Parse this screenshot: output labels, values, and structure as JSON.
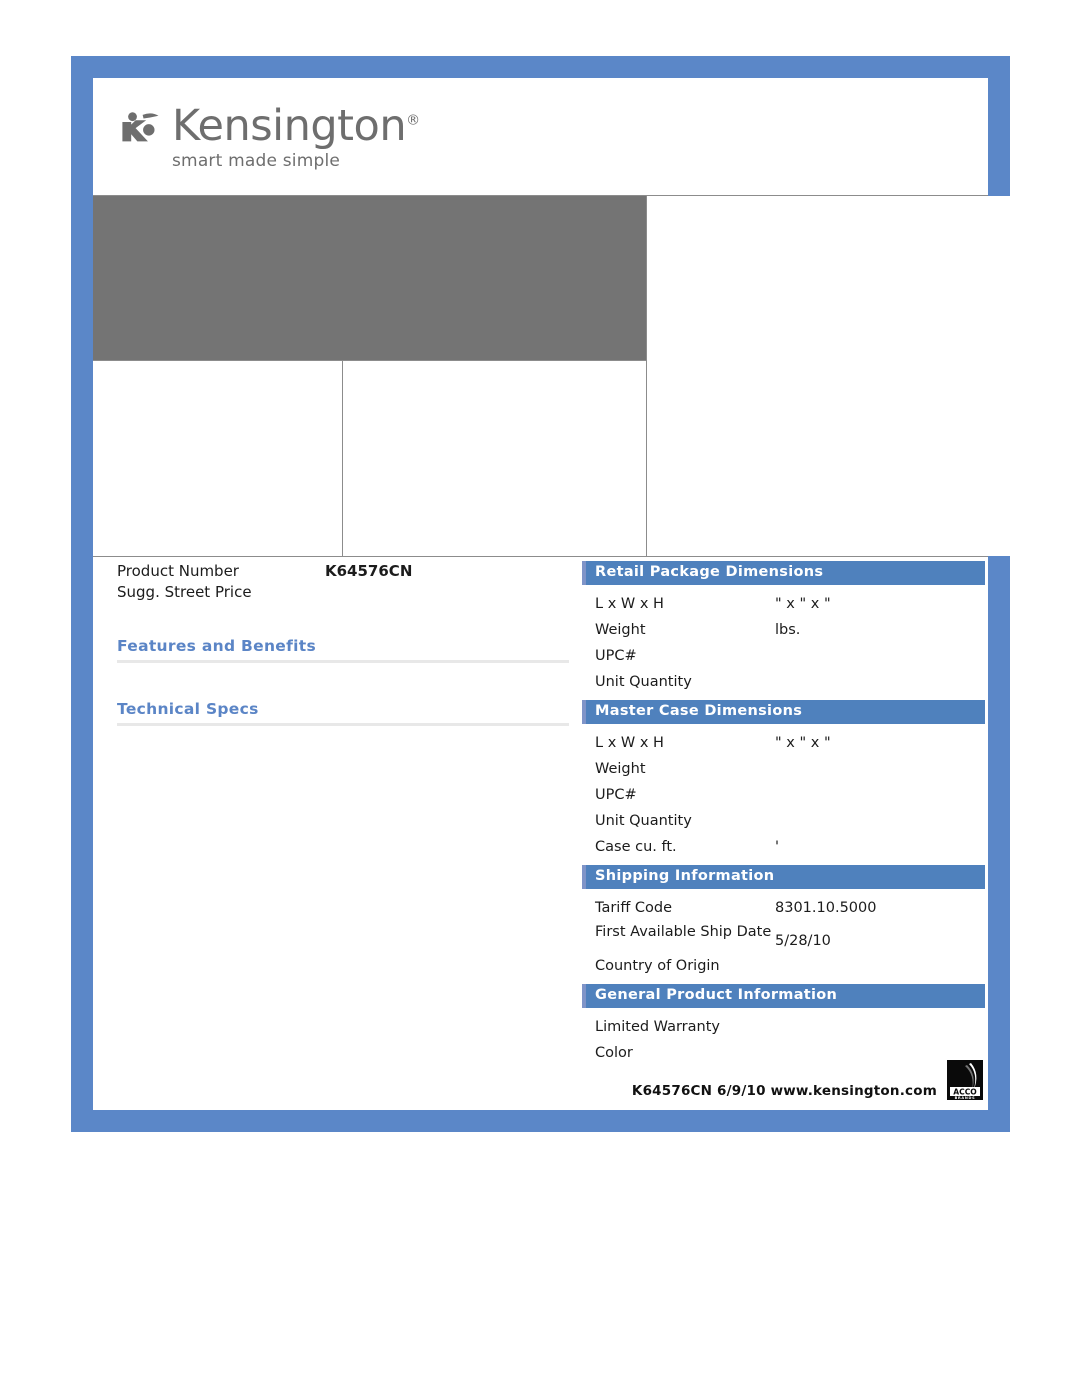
{
  "brand": {
    "name": "Kensington",
    "registered_mark": "®",
    "tagline": "smart made simple",
    "logo_icon": "kensington-figure-icon"
  },
  "product": {
    "number_label": "Product Number",
    "number_value": "K64576CN",
    "price_label": "Sugg. Street Price",
    "price_value": ""
  },
  "left_sections": {
    "features_heading": "Features and Benefits",
    "features_body": "",
    "tech_specs_heading": "Technical Specs",
    "tech_specs_body": ""
  },
  "retail_package": {
    "title": "Retail Package Dimensions",
    "rows": [
      {
        "label": "L x W x H",
        "value": "\" x \" x \""
      },
      {
        "label": "Weight",
        "value": "lbs."
      },
      {
        "label": "UPC#",
        "value": ""
      },
      {
        "label": "Unit Quantity",
        "value": ""
      }
    ]
  },
  "master_case": {
    "title": "Master Case Dimensions",
    "rows": [
      {
        "label": "L x W x H",
        "value": "\" x \" x \""
      },
      {
        "label": "Weight",
        "value": ""
      },
      {
        "label": "UPC#",
        "value": ""
      },
      {
        "label": "Unit Quantity",
        "value": ""
      },
      {
        "label": "Case cu. ft.",
        "value": "'"
      }
    ]
  },
  "shipping": {
    "title": "Shipping Information",
    "rows": [
      {
        "label": "Tariff Code",
        "value": "8301.10.5000"
      },
      {
        "label": "First Available Ship Date",
        "value": "5/28/10"
      },
      {
        "label": "Country of Origin",
        "value": ""
      }
    ]
  },
  "general_info": {
    "title": "General Product Information",
    "rows": [
      {
        "label": "Limited Warranty",
        "value": ""
      },
      {
        "label": "Color",
        "value": ""
      }
    ]
  },
  "footer": {
    "text": "K64576CN  6/9/10  www.kensington.com",
    "logo_primary": "ACCO",
    "logo_secondary": "BRANDS",
    "logo_icon": "acco-brands-logo"
  },
  "colors": {
    "frame_blue": "#5b87c8",
    "bar_blue": "#4f81bd",
    "heading_blue": "#5b85c6",
    "hero_gray": "#747474",
    "rule_gray": "#e8e8e8"
  }
}
